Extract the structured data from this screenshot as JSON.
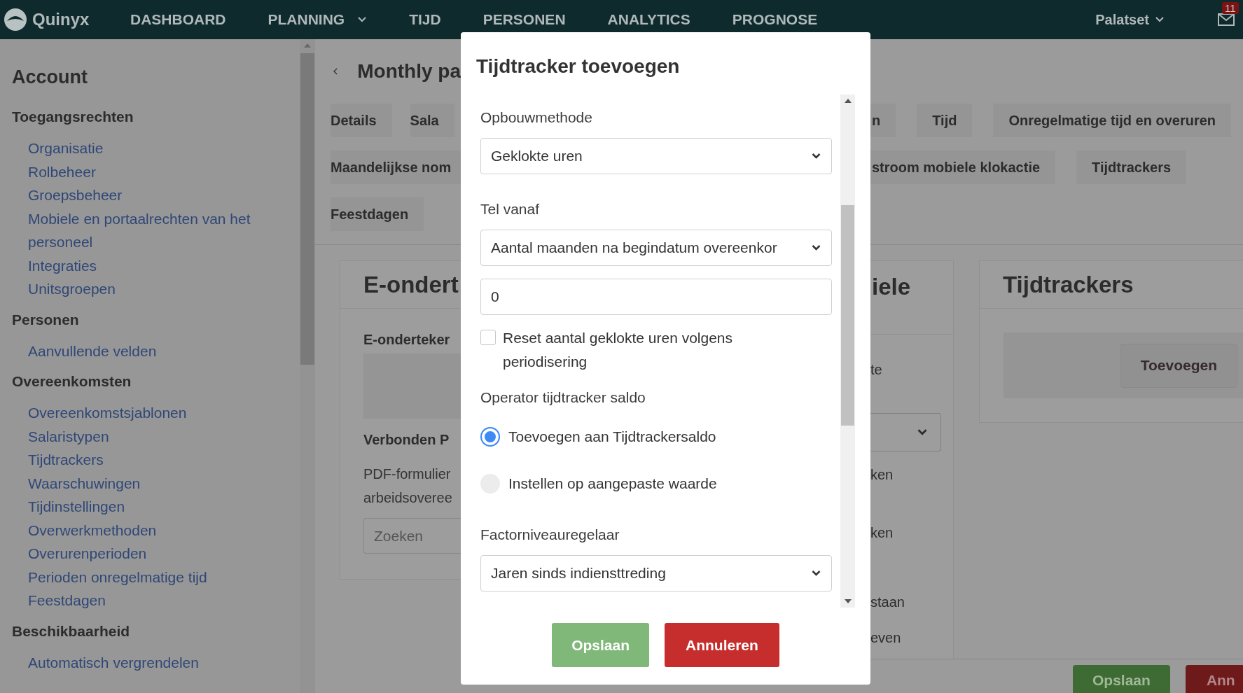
{
  "nav": {
    "logo": "Quinyx",
    "items": [
      {
        "label": "DASHBOARD",
        "dropdown": false
      },
      {
        "label": "PLANNING",
        "dropdown": true
      },
      {
        "label": "TIJD",
        "dropdown": false
      },
      {
        "label": "PERSONEN",
        "dropdown": false
      },
      {
        "label": "ANALYTICS",
        "dropdown": false
      },
      {
        "label": "PROGNOSE",
        "dropdown": false
      }
    ],
    "account": "Palatset",
    "mail_badge": "11"
  },
  "sidebar": {
    "title": "Account",
    "groups": [
      {
        "heading": "Toegangsrechten",
        "items": [
          "Organisatie",
          "Rolbeheer",
          "Groepsbeheer",
          "Mobiele en portaalrechten van het personeel",
          "Integraties",
          "Unitsgroepen"
        ]
      },
      {
        "heading": "Personen",
        "items": [
          "Aanvullende velden"
        ]
      },
      {
        "heading": "Overeenkomsten",
        "items": [
          "Overeenkomstsjablonen",
          "Salaristypen",
          "Tijdtrackers",
          "Waarschuwingen",
          "Tijdinstellingen",
          "Overwerkmethoden",
          "Overurenperioden",
          "Perioden onregelmatige tijd",
          "Feestdagen"
        ]
      },
      {
        "heading": "Beschikbaarheid",
        "items": [
          "Automatisch vergrendelen"
        ]
      }
    ]
  },
  "page": {
    "title": "Monthly pa",
    "tab_rows": [
      {
        "left": [
          "Details",
          "Sala"
        ],
        "right": [
          "n",
          "Tijd",
          "Onregelmatige tijd en overuren"
        ]
      },
      {
        "left": [
          "Maandelijkse nom"
        ],
        "right": [
          "stroom mobiele klokactie",
          "Tijdtrackers"
        ]
      },
      {
        "left": [
          "Feestdagen"
        ]
      }
    ],
    "left_card": {
      "title": "E-ondert",
      "subtitle": "E-onderteker",
      "section": "Verbonden P",
      "text_lines": [
        "PDF-formulier",
        "arbeidsoveree"
      ],
      "search_placeholder": "Zoeken"
    },
    "middle_card": {
      "title": "iele",
      "lines": [
        {
          "kind": "text",
          "text": "te"
        },
        {
          "kind": "select"
        },
        {
          "kind": "text",
          "text": "ken"
        },
        {
          "kind": "text",
          "text": "ken"
        },
        {
          "kind": "text",
          "text": "staan"
        },
        {
          "kind": "text",
          "text": "even"
        }
      ]
    },
    "right_card": {
      "title": "Tijdtrackers",
      "button": "Toevoegen"
    },
    "footer": {
      "save": "Opslaan",
      "cancel": "Ann"
    }
  },
  "modal": {
    "title": "Tijdtracker toevoegen",
    "fields": [
      {
        "kind": "select",
        "label": "Opbouwmethode",
        "value": "Geklokte uren"
      },
      {
        "kind": "select",
        "label": "Tel vanaf",
        "value": "Aantal maanden na begindatum overeenkor"
      },
      {
        "kind": "input",
        "value": "0"
      },
      {
        "kind": "checkbox",
        "label": "Reset aantal geklokte uren volgens periodisering",
        "checked": false
      },
      {
        "kind": "radio_group",
        "label": "Operator tijdtracker saldo",
        "options": [
          {
            "label": "Toevoegen aan Tijdtrackersaldo",
            "selected": true
          },
          {
            "label": "Instellen op aangepaste waarde",
            "selected": false
          }
        ]
      },
      {
        "kind": "select",
        "label": "Factorniveauregelaar",
        "value": "Jaren sinds indiensttreding"
      }
    ],
    "buttons": [
      {
        "label": "Opslaan",
        "disabled": true
      },
      {
        "label": "Annuleren",
        "disabled": false
      }
    ]
  }
}
